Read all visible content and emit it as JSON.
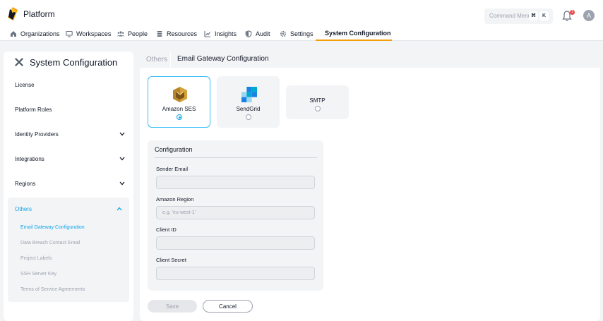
{
  "header": {
    "brand": "Platform",
    "command_menu": {
      "label": "Command Menu",
      "key1": "⌘",
      "key2": "K"
    },
    "notifications": {
      "count": "1"
    },
    "avatar": "A"
  },
  "nav": {
    "items": [
      {
        "label": "Organizations",
        "icon": "home-icon"
      },
      {
        "label": "Workspaces",
        "icon": "monitor-icon"
      },
      {
        "label": "People",
        "icon": "people-icon"
      },
      {
        "label": "Resources",
        "icon": "database-icon"
      },
      {
        "label": "Insights",
        "icon": "chart-icon"
      },
      {
        "label": "Audit",
        "icon": "shield-icon"
      },
      {
        "label": "Settings",
        "icon": "gear-icon"
      },
      {
        "label": "System Configuration",
        "icon": "tools-icon",
        "active": true
      }
    ]
  },
  "sidebar": {
    "title": "System Configuration",
    "items": [
      {
        "label": "License"
      },
      {
        "label": "Platform Roles"
      },
      {
        "label": "Identity Providers"
      },
      {
        "label": "Integrations"
      },
      {
        "label": "Regions"
      }
    ],
    "others": {
      "label": "Others",
      "sub_items": [
        {
          "label": "Email Gateway Configuration",
          "active": true
        },
        {
          "label": "Data Breach Contact Email"
        },
        {
          "label": "Project Labels"
        },
        {
          "label": "SSH Server Key"
        },
        {
          "label": "Terms of Service Agreements"
        }
      ]
    }
  },
  "main": {
    "breadcrumb": {
      "parent": "Others",
      "title": "Email Gateway Configuration"
    },
    "providers": [
      {
        "name": "Amazon SES",
        "icon": "amazon-ses-icon",
        "selected": true
      },
      {
        "name": "SendGrid",
        "icon": "sendgrid-icon",
        "selected": false
      },
      {
        "name": "SMTP",
        "selected": false
      }
    ],
    "config": {
      "title": "Configuration",
      "fields": [
        {
          "label": "Sender Email",
          "value": "",
          "placeholder": ""
        },
        {
          "label": "Amazon Region",
          "value": "",
          "placeholder": "e.g. 'eu-west-1'"
        },
        {
          "label": "Client ID",
          "value": "",
          "placeholder": ""
        },
        {
          "label": "Client Secret",
          "value": "",
          "placeholder": ""
        }
      ]
    },
    "buttons": {
      "save": "Save",
      "cancel": "Cancel"
    }
  },
  "colors": {
    "accent": "#0ea5e9",
    "tab_underline": "#f59e0b",
    "badge": "#ef4444"
  }
}
